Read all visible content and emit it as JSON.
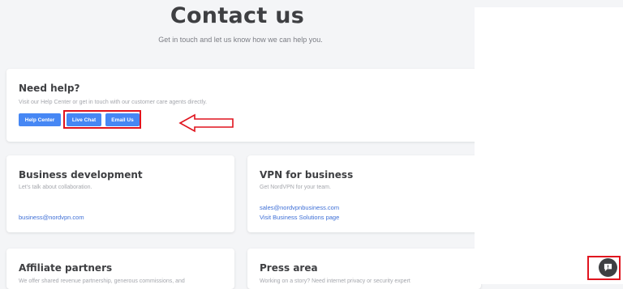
{
  "header": {
    "title": "Contact us",
    "subtitle": "Get in touch and let us know how we can help you."
  },
  "need_help": {
    "title": "Need help?",
    "description": "Visit our Help Center or get in touch with our customer care agents directly.",
    "buttons": {
      "help_center": "Help Center",
      "live_chat": "Live Chat",
      "email_us": "Email Us"
    }
  },
  "business_development": {
    "title": "Business development",
    "description": "Let's talk about collaboration.",
    "email": "business@nordvpn.com"
  },
  "vpn_business": {
    "title": "VPN for business",
    "description": "Get NordVPN for your team.",
    "email": "sales@nordvpnbusiness.com",
    "link": "Visit Business Solutions page"
  },
  "affiliate": {
    "title": "Affiliate partners",
    "description": "We offer shared revenue partnership, generous commissions, and"
  },
  "press": {
    "title": "Press area",
    "description": "Working on a story? Need internet privacy or security expert"
  },
  "colors": {
    "accent_button": "#4687f4",
    "annotation_red": "#e0141e",
    "link": "#3e6fd6"
  },
  "icons": {
    "annotation_arrow": "left-arrow-icon",
    "chat": "chat-bubble-icon"
  }
}
